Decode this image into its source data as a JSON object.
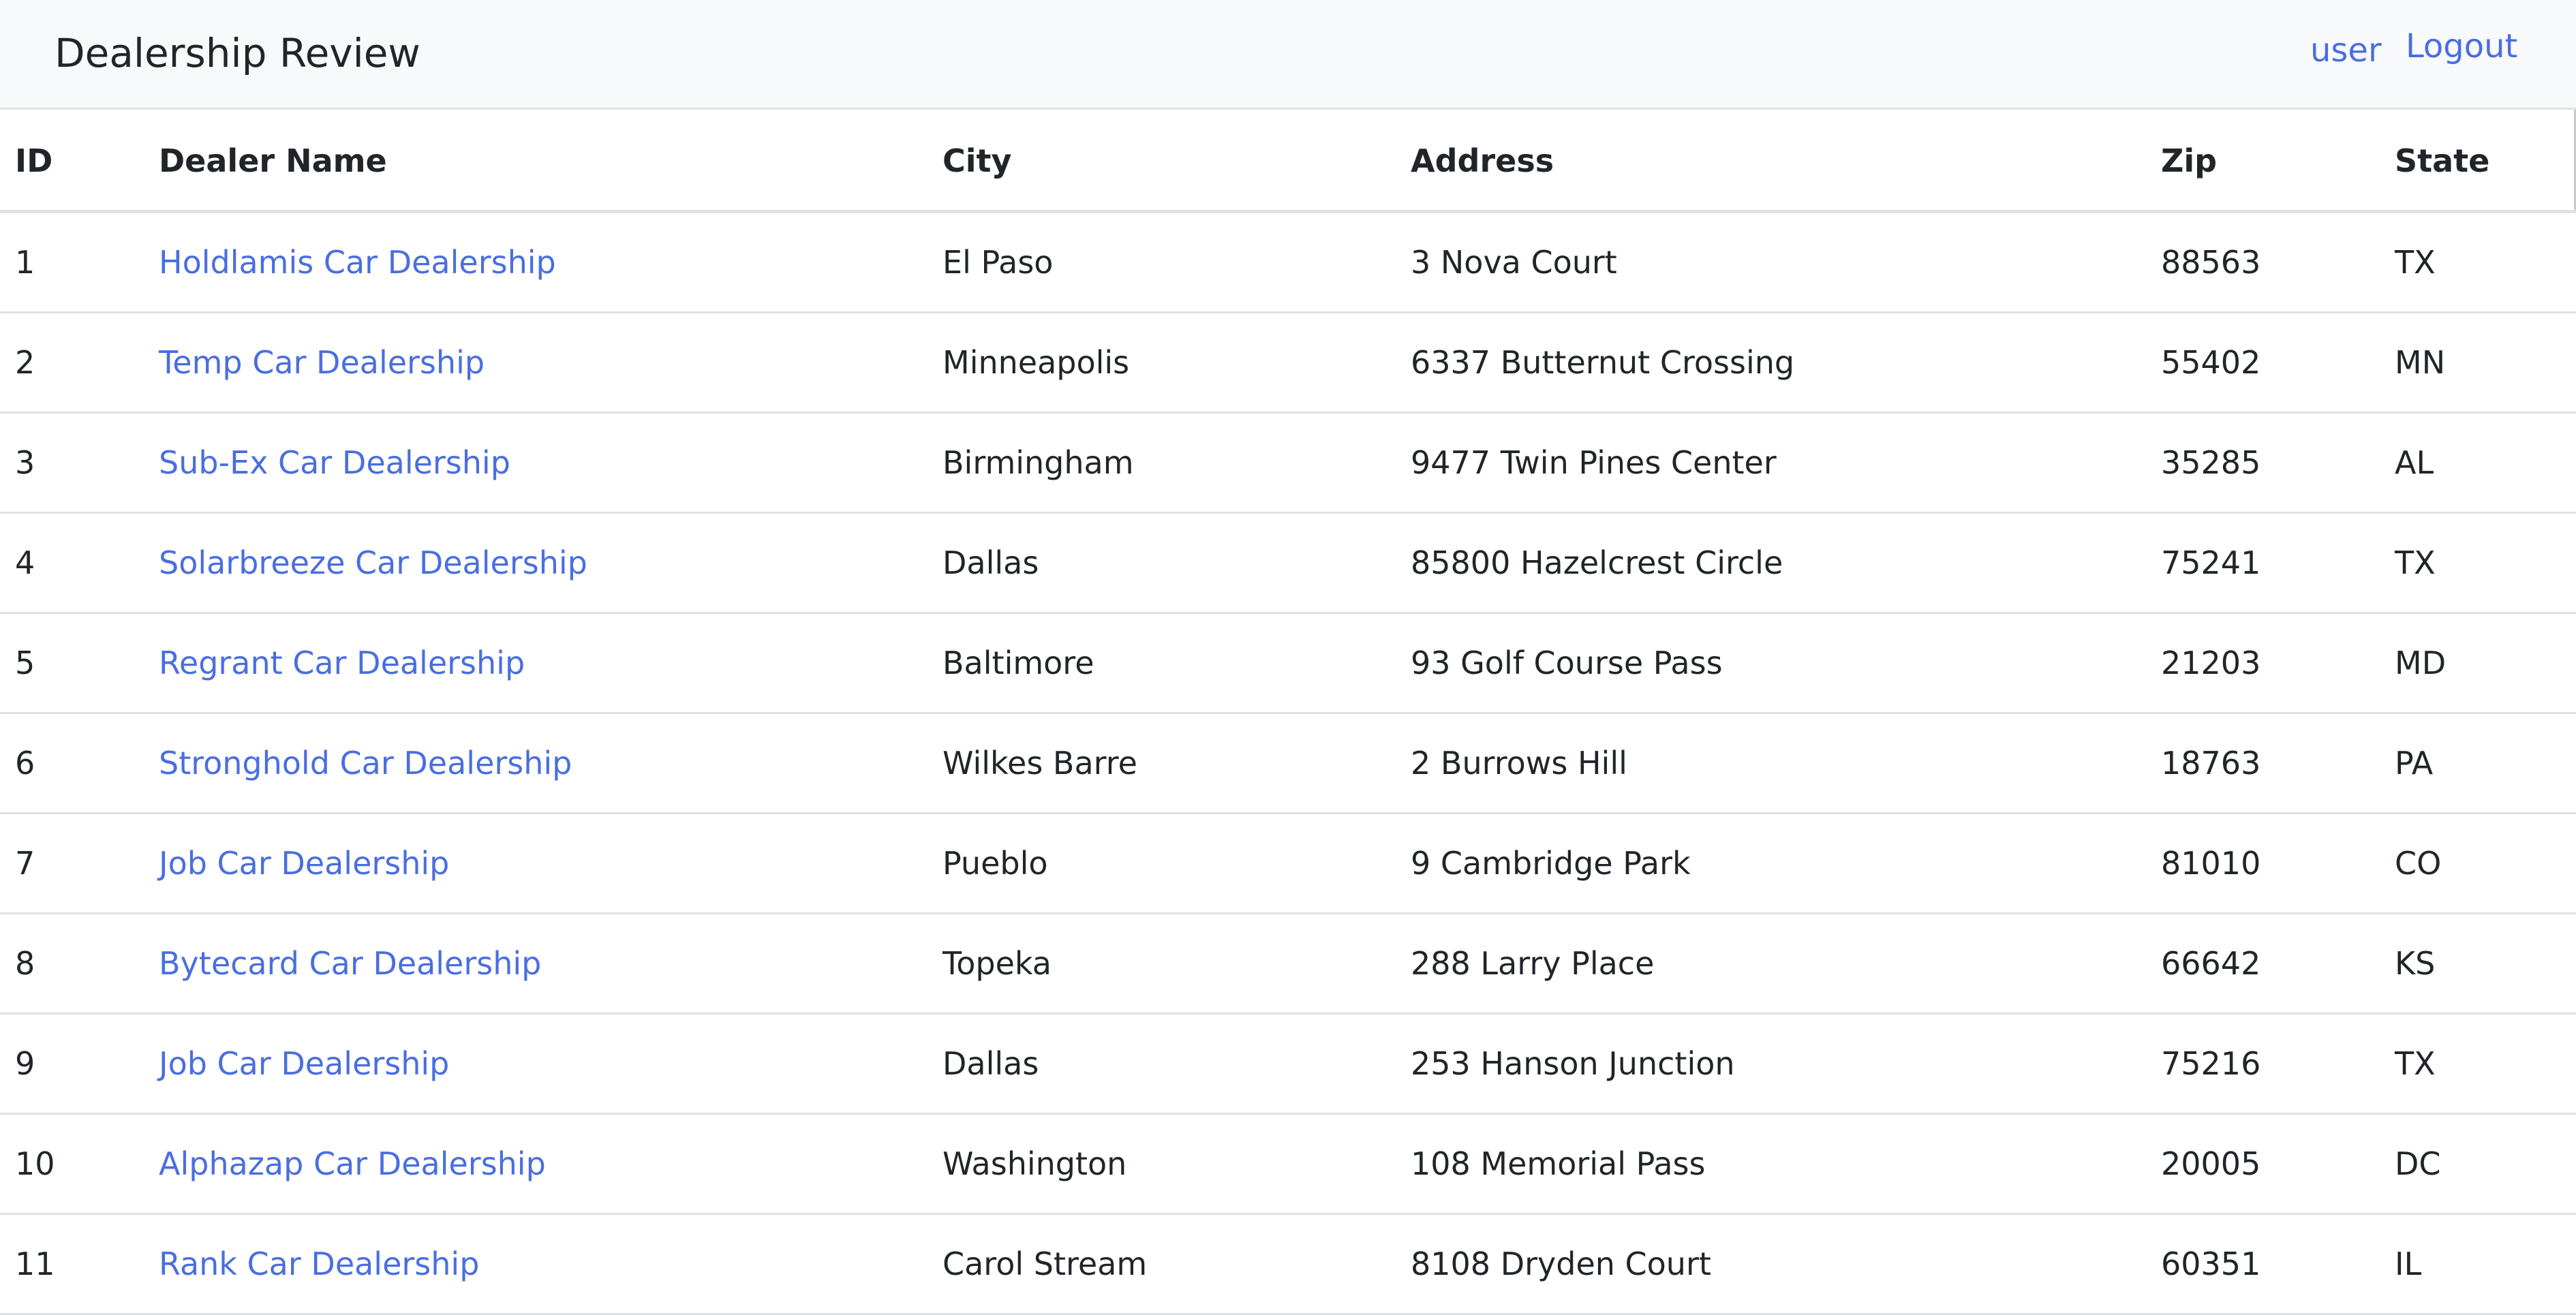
{
  "navbar": {
    "brand": "Dealership Review",
    "user_label": "user",
    "logout_label": "Logout"
  },
  "table": {
    "headers": {
      "id": "ID",
      "name": "Dealer Name",
      "city": "City",
      "address": "Address",
      "zip": "Zip",
      "state": "State"
    },
    "rows": [
      {
        "id": "1",
        "name": "Holdlamis Car Dealership",
        "city": "El Paso",
        "address": "3 Nova Court",
        "zip": "88563",
        "state": "TX"
      },
      {
        "id": "2",
        "name": "Temp Car Dealership",
        "city": "Minneapolis",
        "address": "6337 Butternut Crossing",
        "zip": "55402",
        "state": "MN"
      },
      {
        "id": "3",
        "name": "Sub-Ex Car Dealership",
        "city": "Birmingham",
        "address": "9477 Twin Pines Center",
        "zip": "35285",
        "state": "AL"
      },
      {
        "id": "4",
        "name": "Solarbreeze Car Dealership",
        "city": "Dallas",
        "address": "85800 Hazelcrest Circle",
        "zip": "75241",
        "state": "TX"
      },
      {
        "id": "5",
        "name": "Regrant Car Dealership",
        "city": "Baltimore",
        "address": "93 Golf Course Pass",
        "zip": "21203",
        "state": "MD"
      },
      {
        "id": "6",
        "name": "Stronghold Car Dealership",
        "city": "Wilkes Barre",
        "address": "2 Burrows Hill",
        "zip": "18763",
        "state": "PA"
      },
      {
        "id": "7",
        "name": "Job Car Dealership",
        "city": "Pueblo",
        "address": "9 Cambridge Park",
        "zip": "81010",
        "state": "CO"
      },
      {
        "id": "8",
        "name": "Bytecard Car Dealership",
        "city": "Topeka",
        "address": "288 Larry Place",
        "zip": "66642",
        "state": "KS"
      },
      {
        "id": "9",
        "name": "Job Car Dealership",
        "city": "Dallas",
        "address": "253 Hanson Junction",
        "zip": "75216",
        "state": "TX"
      },
      {
        "id": "10",
        "name": "Alphazap Car Dealership",
        "city": "Washington",
        "address": "108 Memorial Pass",
        "zip": "20005",
        "state": "DC"
      },
      {
        "id": "11",
        "name": "Rank Car Dealership",
        "city": "Carol Stream",
        "address": "8108 Dryden Court",
        "zip": "60351",
        "state": "IL"
      }
    ]
  }
}
